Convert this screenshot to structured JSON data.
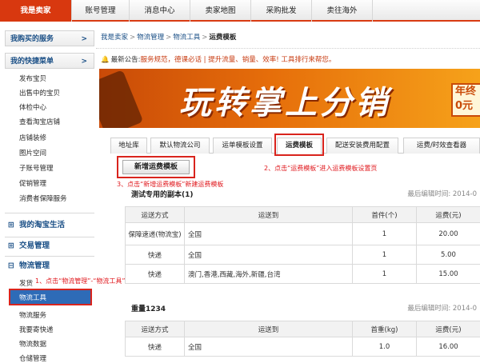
{
  "topnav": {
    "tabs": [
      "我是卖家",
      "账号管理",
      "消息中心",
      "卖家地图",
      "采购批发",
      "卖往海外"
    ]
  },
  "sidebar": {
    "services_label": "我购买的服务",
    "services_arrow": ">",
    "quick_label": "我的快捷菜单",
    "quick_arrow": ">",
    "quick_items": [
      "发布宝贝",
      "出售中的宝贝",
      "体检中心",
      "查看淘宝店铺",
      "店铺装修",
      "图片空间",
      "子账号管理",
      "促销管理",
      "消费者保障服务"
    ],
    "groups": {
      "taobao_life": "我的淘宝生活",
      "trade": "交易管理",
      "logistics": "物流管理"
    },
    "group_markers": {
      "collapsed": "⊞",
      "expanded": "⊟"
    },
    "logistics_items": [
      "发货",
      "物流工具",
      "物流服务",
      "我要寄快递",
      "物流数据",
      "仓储管理"
    ]
  },
  "breadcrumb": {
    "items": [
      "我是卖家",
      "物流管理",
      "物流工具"
    ],
    "separator": ">",
    "current": "运费模板"
  },
  "announcement": {
    "prefix": "最新公告:",
    "links": "服务规范，德课必话 | 提升流量、销量、效率! 工具排行来帮您。"
  },
  "banner": {
    "headline": "玩转掌上分销",
    "badge_top": "年终",
    "badge_bottom": "0元"
  },
  "tabs": [
    "地址库",
    "默认物流公司",
    "运单模板设置",
    "运费模板",
    "配送安装费用配置",
    "运费/时效查看器"
  ],
  "add_button": "新增运费模板",
  "annotations": {
    "step1": "1、点击“物流管理”-“物流工具”",
    "step2": "2、点击“运费模板”进入运费模板设置页",
    "step3": "3、点击“新增运费模板”新建运费模板"
  },
  "templates": [
    {
      "name": "测试专用的副本(1)",
      "edit_time": "最后编辑时间: 2014-0",
      "headers": [
        "运送方式",
        "运送到",
        "首件(个)",
        "运费(元)"
      ],
      "rows": [
        {
          "method": "保障速递(物流宝)",
          "dest": "全国",
          "first": "1",
          "fee": "20.00"
        },
        {
          "method": "快递",
          "dest": "全国",
          "first": "1",
          "fee": "5.00"
        },
        {
          "method": "快递",
          "dest": "澳门,香港,西藏,海外,新疆,台湾",
          "first": "1",
          "fee": "15.00"
        }
      ]
    },
    {
      "name": "重量1234",
      "edit_time": "最后编辑时间: 2014-0",
      "headers": [
        "运送方式",
        "运送到",
        "首重(kg)",
        "运费(元)"
      ],
      "rows": [
        {
          "method": "快递",
          "dest": "全国",
          "first": "1.0",
          "fee": "16.00"
        }
      ]
    }
  ],
  "colors": {
    "brand_red": "#d8380f",
    "link_blue": "#1a4f86",
    "annotation_red": "#e0191e",
    "active_blue": "#2e6bb7"
  }
}
